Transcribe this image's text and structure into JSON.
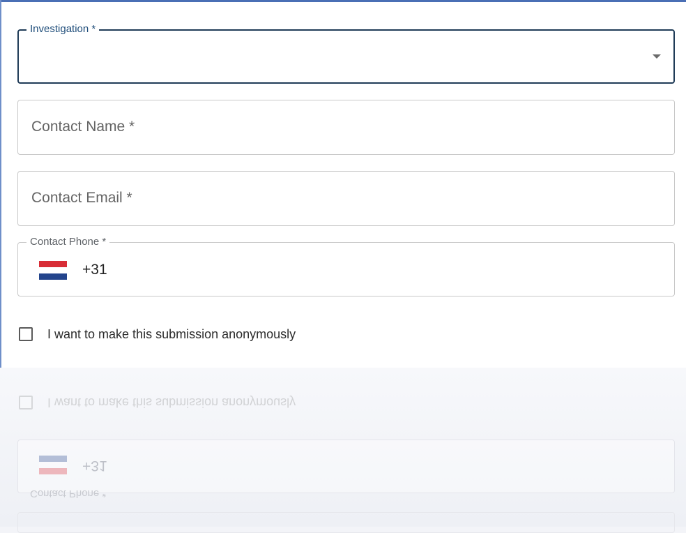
{
  "form": {
    "investigation": {
      "label": "Investigation *",
      "value": ""
    },
    "contact_name": {
      "placeholder": "Contact Name *"
    },
    "contact_email": {
      "placeholder": "Contact Email *"
    },
    "contact_phone": {
      "label": "Contact Phone *",
      "country": "Netherlands",
      "dial_code": "+31"
    },
    "anonymous": {
      "label": "I want to make this submission anonymously",
      "checked": false
    }
  },
  "colors": {
    "focus_border": "#1f3b57",
    "focus_label": "#1f4d7a",
    "flag_red": "#d82d36",
    "flag_white": "#ffffff",
    "flag_blue": "#23448c"
  }
}
